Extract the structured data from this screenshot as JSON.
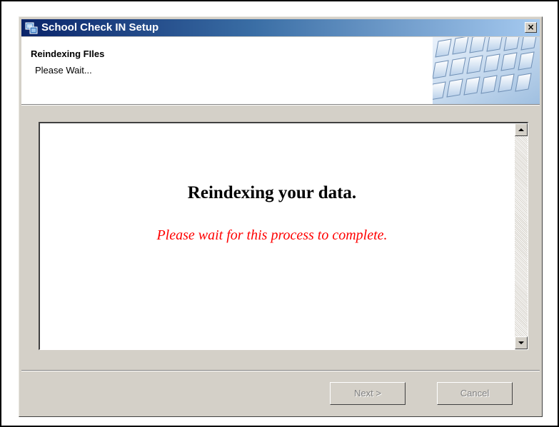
{
  "window": {
    "title": "School Check IN Setup",
    "close_label": "×"
  },
  "header": {
    "title": "Reindexing FIles",
    "subtitle": "Please Wait..."
  },
  "content": {
    "heading": "Reindexing your data.",
    "message": "Please wait for this process to complete."
  },
  "buttons": {
    "next_label": "Next >",
    "cancel_label": "Cancel",
    "next_enabled": false,
    "cancel_enabled": false
  },
  "colors": {
    "titlebar_start": "#0a246a",
    "titlebar_end": "#a6caf0",
    "message_color": "#ff0000",
    "dialog_bg": "#d4d0c8"
  },
  "icons": {
    "title_icon": "setup-app-icon",
    "close_icon": "close-icon",
    "scroll_up": "scroll-up-arrow-icon",
    "scroll_down": "scroll-down-arrow-icon"
  }
}
